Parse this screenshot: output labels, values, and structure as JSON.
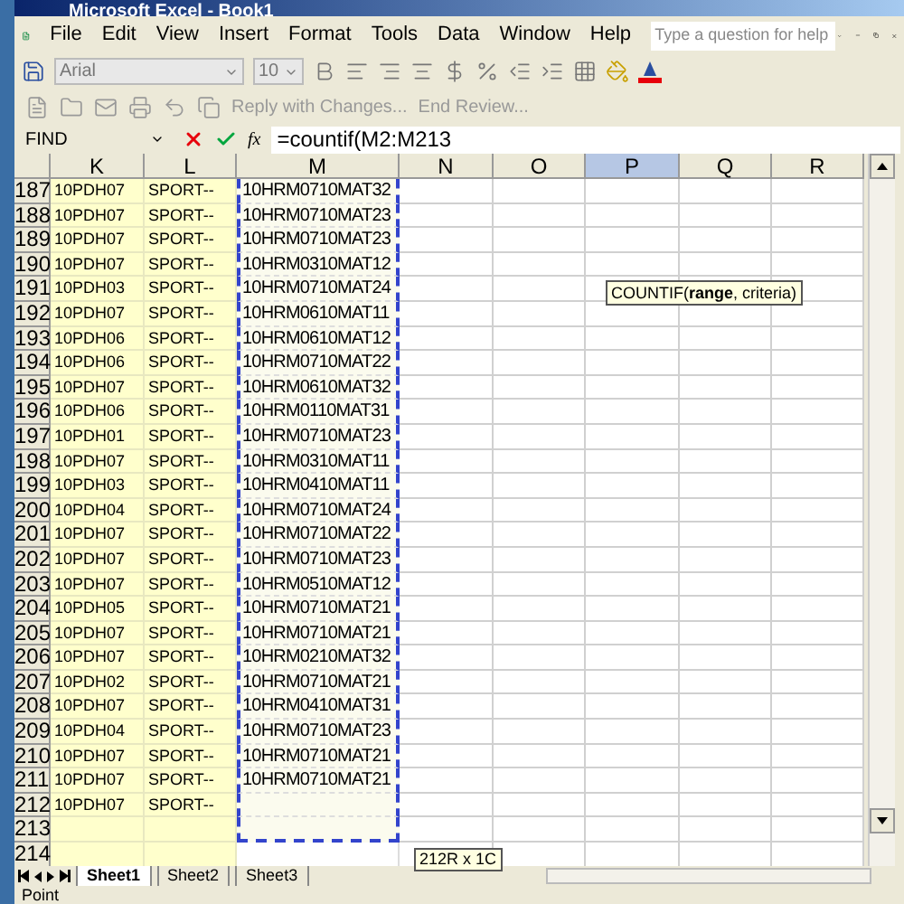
{
  "window": {
    "title": "Microsoft Excel - Book1"
  },
  "menu": [
    "File",
    "Edit",
    "View",
    "Insert",
    "Format",
    "Tools",
    "Data",
    "Window",
    "Help"
  ],
  "help_box": {
    "placeholder": "Type a question for help"
  },
  "formatting": {
    "font": "Arial",
    "size": "10"
  },
  "reviewing": [
    "Reply with Changes...",
    "End Review..."
  ],
  "formula_bar": {
    "name_box": "FIND",
    "function_label": "fx",
    "formula": "=countif(M2:M213"
  },
  "columns": [
    {
      "label": "K",
      "selected": false
    },
    {
      "label": "L",
      "selected": false
    },
    {
      "label": "M",
      "selected": false
    },
    {
      "label": "N",
      "selected": false
    },
    {
      "label": "O",
      "selected": false
    },
    {
      "label": "P",
      "selected": true
    },
    {
      "label": "Q",
      "selected": false
    },
    {
      "label": "R",
      "selected": false
    }
  ],
  "rows": [
    {
      "n": "187",
      "k": "10PDH07",
      "l": "SPORT--",
      "m": "10HRM0710MAT32"
    },
    {
      "n": "188",
      "k": "10PDH07",
      "l": "SPORT--",
      "m": "10HRM0710MAT23"
    },
    {
      "n": "189",
      "k": "10PDH07",
      "l": "SPORT--",
      "m": "10HRM0710MAT23"
    },
    {
      "n": "190",
      "k": "10PDH07",
      "l": "SPORT--",
      "m": "10HRM0310MAT12"
    },
    {
      "n": "191",
      "k": "10PDH03",
      "l": "SPORT--",
      "m": "10HRM0710MAT24"
    },
    {
      "n": "192",
      "k": "10PDH07",
      "l": "SPORT--",
      "m": "10HRM0610MAT11"
    },
    {
      "n": "193",
      "k": "10PDH06",
      "l": "SPORT--",
      "m": "10HRM0610MAT12"
    },
    {
      "n": "194",
      "k": "10PDH06",
      "l": "SPORT--",
      "m": "10HRM0710MAT22"
    },
    {
      "n": "195",
      "k": "10PDH07",
      "l": "SPORT--",
      "m": "10HRM0610MAT32"
    },
    {
      "n": "196",
      "k": "10PDH06",
      "l": "SPORT--",
      "m": "10HRM0110MAT31"
    },
    {
      "n": "197",
      "k": "10PDH01",
      "l": "SPORT--",
      "m": "10HRM0710MAT23"
    },
    {
      "n": "198",
      "k": "10PDH07",
      "l": "SPORT--",
      "m": "10HRM0310MAT11"
    },
    {
      "n": "199",
      "k": "10PDH03",
      "l": "SPORT--",
      "m": "10HRM0410MAT11"
    },
    {
      "n": "200",
      "k": "10PDH04",
      "l": "SPORT--",
      "m": "10HRM0710MAT24"
    },
    {
      "n": "201",
      "k": "10PDH07",
      "l": "SPORT--",
      "m": "10HRM0710MAT22"
    },
    {
      "n": "202",
      "k": "10PDH07",
      "l": "SPORT--",
      "m": "10HRM0710MAT23"
    },
    {
      "n": "203",
      "k": "10PDH07",
      "l": "SPORT--",
      "m": "10HRM0510MAT12"
    },
    {
      "n": "204",
      "k": "10PDH05",
      "l": "SPORT--",
      "m": "10HRM0710MAT21"
    },
    {
      "n": "205",
      "k": "10PDH07",
      "l": "SPORT--",
      "m": "10HRM0710MAT21"
    },
    {
      "n": "206",
      "k": "10PDH07",
      "l": "SPORT--",
      "m": "10HRM0210MAT32"
    },
    {
      "n": "207",
      "k": "10PDH02",
      "l": "SPORT--",
      "m": "10HRM0710MAT21"
    },
    {
      "n": "208",
      "k": "10PDH07",
      "l": "SPORT--",
      "m": "10HRM0410MAT31"
    },
    {
      "n": "209",
      "k": "10PDH04",
      "l": "SPORT--",
      "m": "10HRM0710MAT23"
    },
    {
      "n": "210",
      "k": "10PDH07",
      "l": "SPORT--",
      "m": "10HRM0710MAT21"
    },
    {
      "n": "211",
      "k": "10PDH07",
      "l": "SPORT--",
      "m": "10HRM0710MAT21"
    },
    {
      "n": "212",
      "k": "10PDH07",
      "l": "SPORT--"
    },
    {
      "n": "213"
    },
    {
      "n": "214"
    }
  ],
  "tooltip": "COUNTIF(**range**, criteria)",
  "selection_size": "212R x 1C",
  "sheets": [
    {
      "label": "Sheet1",
      "selected": true
    },
    {
      "label": "Sheet2",
      "selected": false
    },
    {
      "label": "Sheet3",
      "selected": false
    }
  ],
  "status_bar": "Point"
}
